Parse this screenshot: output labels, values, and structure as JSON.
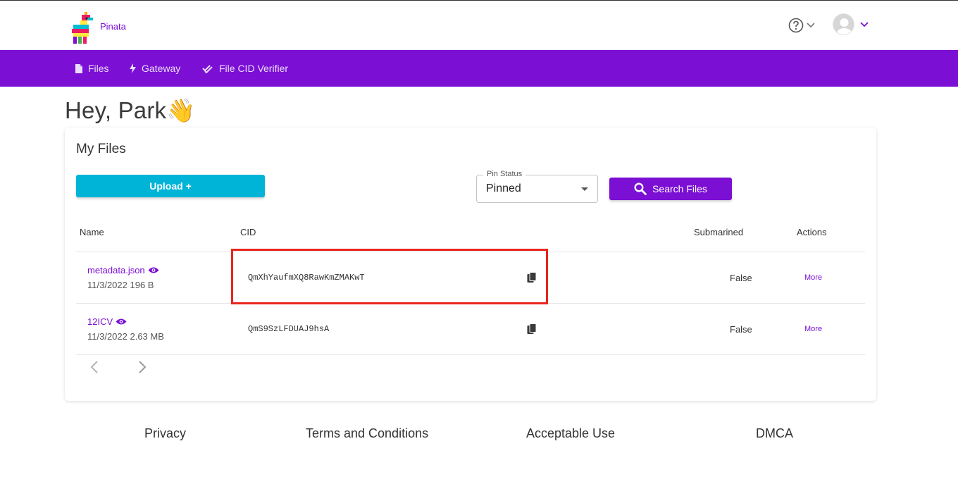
{
  "header": {
    "brand": "Pinata"
  },
  "nav": {
    "items": [
      {
        "label": "Files"
      },
      {
        "label": "Gateway"
      },
      {
        "label": "File CID Verifier"
      }
    ]
  },
  "greeting": "Hey, Park👋",
  "files": {
    "title": "My Files",
    "upload_label": "Upload +",
    "pin_status": {
      "label": "Pin Status",
      "value": "Pinned"
    },
    "search_label": "Search Files",
    "columns": [
      "Name",
      "CID",
      "Submarined",
      "Actions"
    ],
    "rows": [
      {
        "name": "metadata.json",
        "meta": "11/3/2022 196 B",
        "cid": "QmXhYaufmXQ8RawKmZMAKwT",
        "submarined": "False",
        "action": "More"
      },
      {
        "name": "12ICV",
        "meta": "11/3/2022 2.63 MB",
        "cid": "QmS9SzLFDUAJ9hsA",
        "submarined": "False",
        "action": "More"
      }
    ]
  },
  "footer": {
    "links": [
      "Privacy",
      "Terms and Conditions",
      "Acceptable Use",
      "DMCA"
    ]
  },
  "colors": {
    "brand_purple": "#7b0fd4",
    "upload_cyan": "#00b4d8",
    "highlight_red": "#e8251d"
  }
}
